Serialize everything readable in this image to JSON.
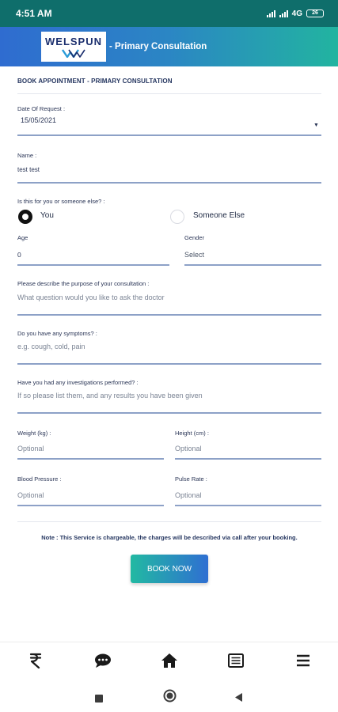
{
  "status": {
    "time": "4:51 AM",
    "network": "4G",
    "battery": "26"
  },
  "header": {
    "logo_text": "WELSPUN",
    "title": "- Primary Consultation"
  },
  "form": {
    "section_title": "BOOK APPOINTMENT - PRIMARY CONSULTATION",
    "date_label": "Date Of Request :",
    "date_value": "15/05/2021",
    "name_label": "Name :",
    "name_value": "test test",
    "for_whom_label": "Is this for you or someone else? :",
    "option_you": "You",
    "option_someone_else": "Someone Else",
    "age_label": "Age",
    "age_value": "0",
    "gender_label": "Gender",
    "gender_value": "Select",
    "purpose_label": "Please describe the purpose of your consultation :",
    "purpose_placeholder": "What question would you like to ask the doctor",
    "symptoms_label": "Do you have any symptoms? :",
    "symptoms_placeholder": "e.g. cough, cold, pain",
    "investigations_label": "Have you had any investigations performed? :",
    "investigations_placeholder": "If so please list them, and any results you have been given",
    "weight_label": "Weight (kg) :",
    "weight_placeholder": "Optional",
    "height_label": "Height (cm) :",
    "height_placeholder": "Optional",
    "bp_label": "Blood Pressure :",
    "bp_placeholder": "Optional",
    "pulse_label": "Pulse Rate :",
    "pulse_placeholder": "Optional",
    "note": "Note : This Service is chargeable, the charges will be described via call after your booking.",
    "book_button": "BOOK NOW"
  },
  "bottom_nav": {
    "items": [
      {
        "icon": "rupee-icon"
      },
      {
        "icon": "chat-icon"
      },
      {
        "icon": "home-icon"
      },
      {
        "icon": "list-icon"
      },
      {
        "icon": "menu-icon"
      }
    ]
  },
  "system_nav": {
    "items": [
      "recents-icon",
      "home-circle-icon",
      "back-icon"
    ]
  },
  "colors": {
    "status_bar": "#0f6e6b",
    "header_start": "#2f6cd0",
    "header_end": "#22b4a0",
    "field_line": "#8da1c7",
    "text_dark": "#253660"
  }
}
